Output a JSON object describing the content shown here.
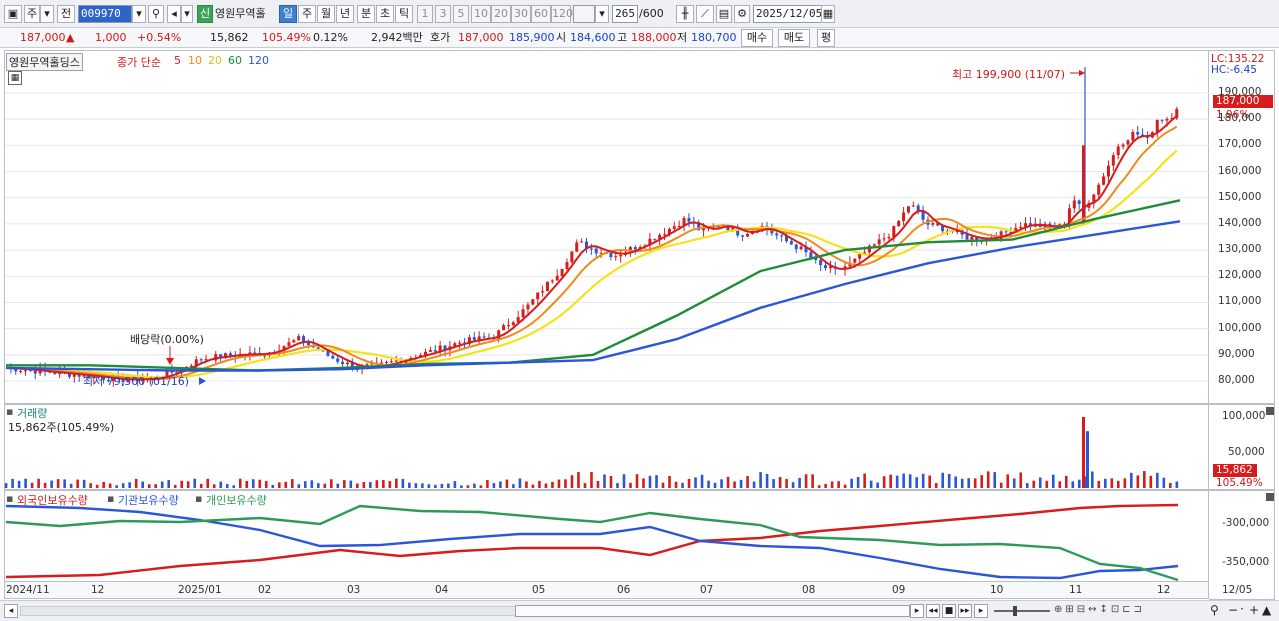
{
  "toolbar": {
    "period_btn": "주",
    "prev_btn": "전",
    "code": "009970",
    "stock_short": "영원무역홀",
    "new_badge": "신",
    "periods": [
      "일",
      "주",
      "월",
      "년",
      "분",
      "초",
      "틱"
    ],
    "nums": [
      "1",
      "3",
      "5",
      "10",
      "20",
      "30",
      "60",
      "120"
    ],
    "count": "265",
    "count_total": "/600",
    "date": "2025/12/05"
  },
  "quote": {
    "price": "187,000",
    "arrow": "▲",
    "change": "1,000",
    "change_pct": "+0.54%",
    "volume": "15,862",
    "vol_ratio": "105.49%",
    "turnover": "0.12%",
    "amount": "2,942백만",
    "ask_label": "호가",
    "ask": "187,000",
    "bid": "185,900",
    "open_label": "시",
    "open": "184,600",
    "high_label": "고",
    "high": "188,000",
    "low_label": "저",
    "low": "180,700",
    "buy": "매수",
    "sell": "매도",
    "avg": "평"
  },
  "price_pane": {
    "name": "영원무역홀딩스",
    "ma_label": "종가 단순",
    "ma_periods": [
      "5",
      "10",
      "20",
      "60",
      "120"
    ],
    "ma_colors": [
      "#d81b1b",
      "#f08a1a",
      "#f5e21a",
      "#1e8c3a",
      "#2a56d8"
    ],
    "high_note": "최고 199,900 (11/07)",
    "low_note": "최저 79,500 (01/16)",
    "div_note": "배당락(0.00%)",
    "lc": "LC:135.22",
    "hc": "HC:-6.45",
    "cur_price": "187,000",
    "cur_pct": "1.96%",
    "y_ticks": [
      "190,000",
      "180,000",
      "170,000",
      "160,000",
      "150,000",
      "140,000",
      "130,000",
      "120,000",
      "110,000",
      "100,000",
      "90,000",
      "80,000"
    ]
  },
  "volume_pane": {
    "title": "거래량",
    "info": "15,862주(105.49%)",
    "y_ticks": [
      "100,000",
      "50,000"
    ],
    "cur": "15,862",
    "cur_pct": "105.49%"
  },
  "holding_pane": {
    "labels": [
      "외국인보유수량",
      "기관보유수량",
      "개인보유수량"
    ],
    "colors": [
      "#d81b1b",
      "#2a56d8",
      "#2e9a5a"
    ],
    "y_ticks": [
      "-300,000",
      "-350,000"
    ]
  },
  "x_axis": {
    "ticks": [
      "2024/11",
      "12",
      "2025/01",
      "02",
      "03",
      "04",
      "05",
      "06",
      "07",
      "08",
      "09",
      "10",
      "11",
      "12"
    ],
    "end": "12/05"
  },
  "chart_data": {
    "type": "line",
    "title": "영원무역홀딩스",
    "x": [
      "2024/11",
      "12",
      "2025/01",
      "02",
      "03",
      "04",
      "05",
      "06",
      "07",
      "08",
      "09",
      "10",
      "11",
      "12"
    ],
    "series": [
      {
        "name": "종가",
        "values": [
          84500,
          83000,
          81000,
          82000,
          90000,
          90000,
          88000,
          94000,
          135000,
          138000,
          125000,
          132000,
          142000,
          180000,
          187000
        ]
      },
      {
        "name": "60",
        "values": [
          86000,
          86000,
          85000,
          84000,
          85000,
          86500,
          87000,
          90000,
          105000,
          122000,
          130000,
          133000,
          134000,
          142000,
          149000
        ]
      },
      {
        "name": "120",
        "values": [
          85000,
          84500,
          84000,
          84000,
          84500,
          86000,
          87000,
          88000,
          96000,
          108000,
          117000,
          125000,
          131000,
          136000,
          141000
        ]
      }
    ],
    "ylim": [
      75000,
      200000
    ]
  }
}
